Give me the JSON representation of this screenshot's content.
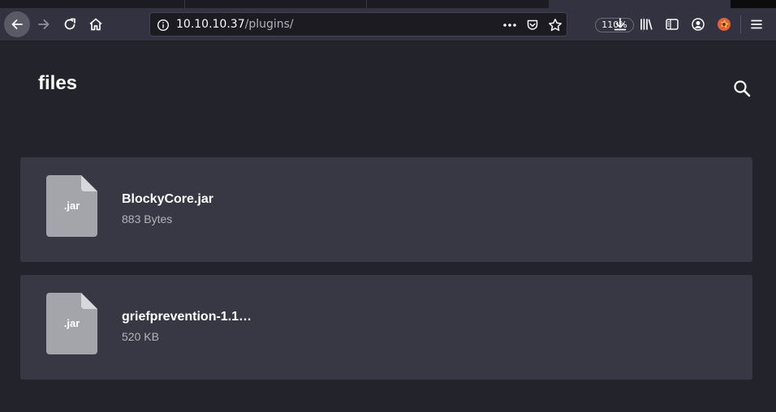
{
  "browser": {
    "url": {
      "host": "10.10.10.37",
      "path": "/plugins/"
    },
    "zoom": "110%",
    "icons": {
      "back": "back-arrow-icon",
      "forward": "forward-arrow-icon",
      "reload": "reload-icon",
      "home": "home-icon",
      "info": "info-icon",
      "page_actions": "more-dots-icon",
      "pocket": "pocket-icon",
      "bookmark": "star-icon",
      "downloads": "download-icon",
      "library": "library-icon",
      "sidebar": "sidebar-icon",
      "account": "account-icon",
      "extension": "extension-icon",
      "menu": "hamburger-menu-icon"
    }
  },
  "page": {
    "title": "files",
    "search_icon": "search-icon"
  },
  "files": [
    {
      "ext": ".jar",
      "name": "BlockyCore.jar",
      "size": "883 Bytes"
    },
    {
      "ext": ".jar",
      "name": "griefprevention-1.1…",
      "size": "520 KB"
    }
  ],
  "colors": {
    "page_bg": "#23232c",
    "card_bg": "#383844",
    "file_icon": "#a4a4ab",
    "toolbar_bg": "#323240"
  }
}
